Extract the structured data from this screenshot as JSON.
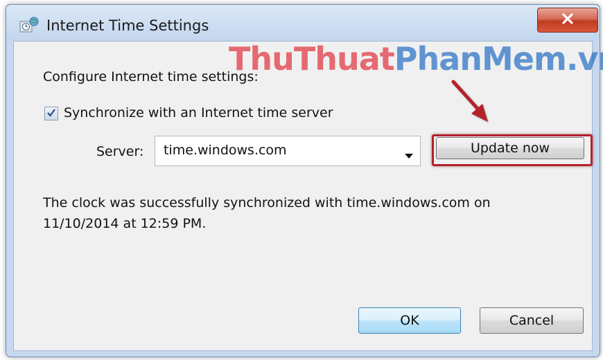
{
  "window": {
    "title": "Internet Time Settings"
  },
  "watermark": {
    "part1": "ThuThuat",
    "part2": "PhanMem.vn"
  },
  "content": {
    "heading": "Configure Internet time settings:",
    "sync_checkbox": {
      "label": "Synchronize with an Internet time server",
      "checked": true
    },
    "server_label": "Server:",
    "server_value": "time.windows.com",
    "update_button": "Update now",
    "status_line1": "The clock was successfully synchronized with time.windows.com on",
    "status_line2": "11/10/2014 at 12:59 PM."
  },
  "buttons": {
    "ok": "OK",
    "cancel": "Cancel"
  },
  "colors": {
    "highlight": "#b3202c",
    "watermark_red": "#e23c47",
    "watermark_blue": "#2f76c6"
  }
}
